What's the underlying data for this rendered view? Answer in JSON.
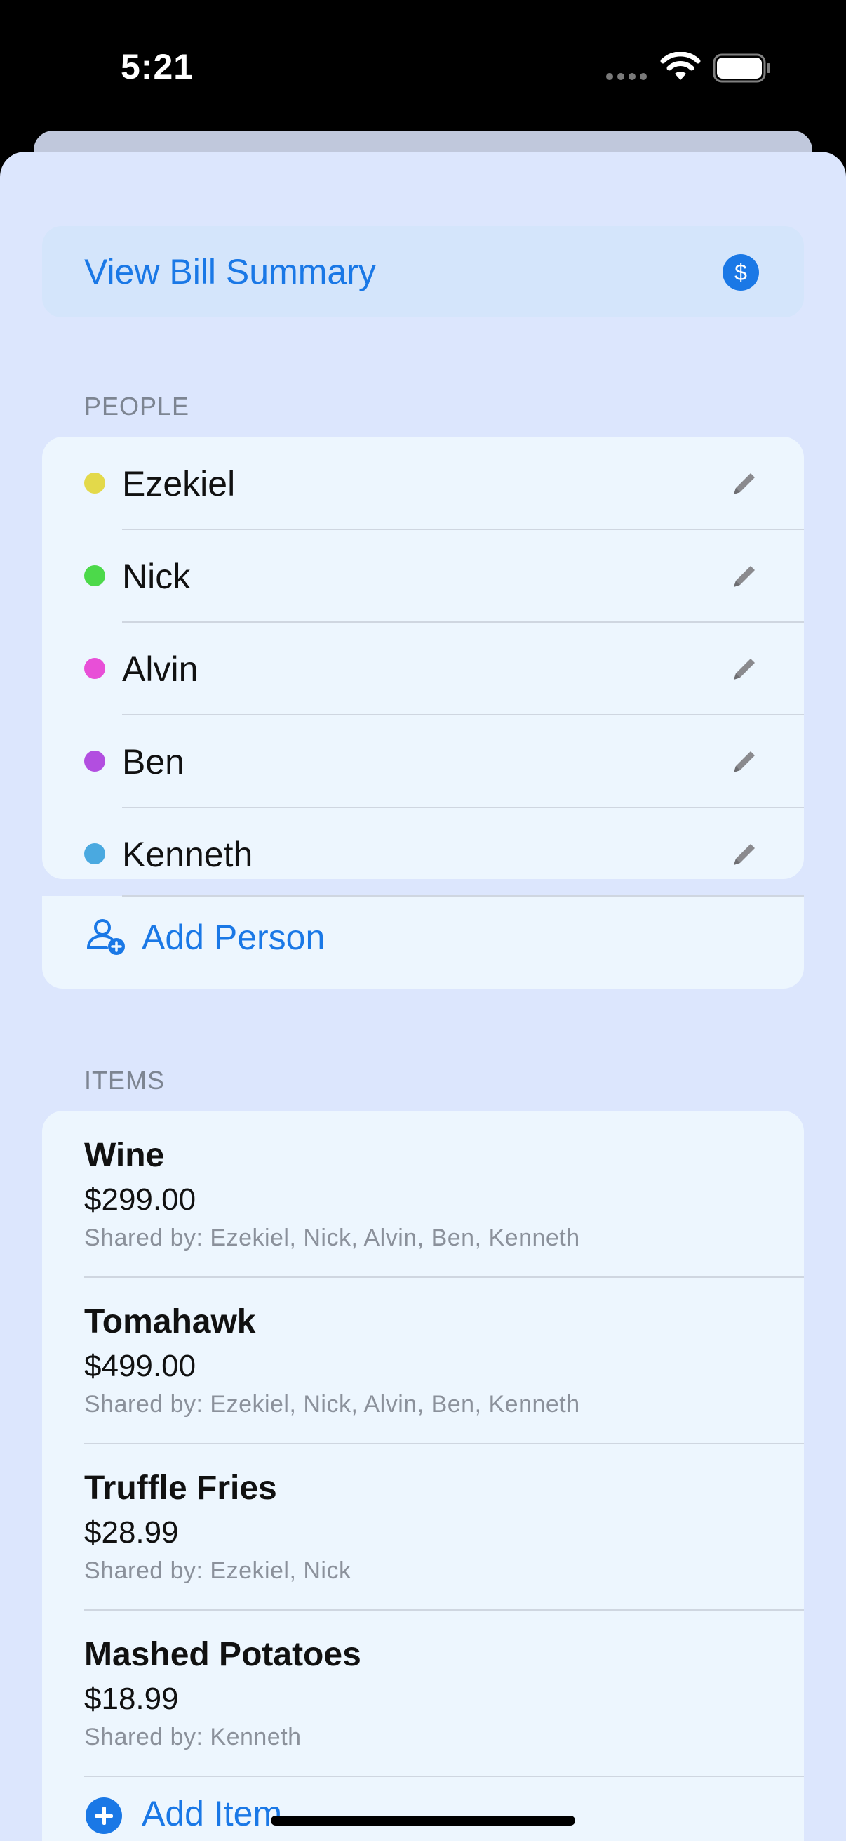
{
  "status_bar": {
    "time": "5:21"
  },
  "summary": {
    "label": "View Bill Summary",
    "icon": "dollar-circle-icon",
    "icon_glyph": "$"
  },
  "people_section": {
    "header": "PEOPLE",
    "people": [
      {
        "name": "Ezekiel",
        "color": "#e3d94a"
      },
      {
        "name": "Nick",
        "color": "#4cd94a"
      },
      {
        "name": "Alvin",
        "color": "#e84fd7"
      },
      {
        "name": "Ben",
        "color": "#b24ee0"
      },
      {
        "name": "Kenneth",
        "color": "#4aa9e0"
      }
    ],
    "add_label": "Add Person"
  },
  "items_section": {
    "header": "ITEMS",
    "items": [
      {
        "name": "Wine",
        "price": "$299.00",
        "shared": "Shared by: Ezekiel, Nick, Alvin, Ben, Kenneth"
      },
      {
        "name": "Tomahawk",
        "price": "$499.00",
        "shared": "Shared by: Ezekiel, Nick, Alvin, Ben, Kenneth"
      },
      {
        "name": "Truffle Fries",
        "price": "$28.99",
        "shared": "Shared by: Ezekiel, Nick"
      },
      {
        "name": "Mashed Potatoes",
        "price": "$18.99",
        "shared": "Shared by: Kenneth"
      }
    ],
    "add_label": "Add Item"
  },
  "colors": {
    "accent": "#1a78e6",
    "sheet_background": "#dce6fd",
    "card_background": "#edf6fe"
  }
}
